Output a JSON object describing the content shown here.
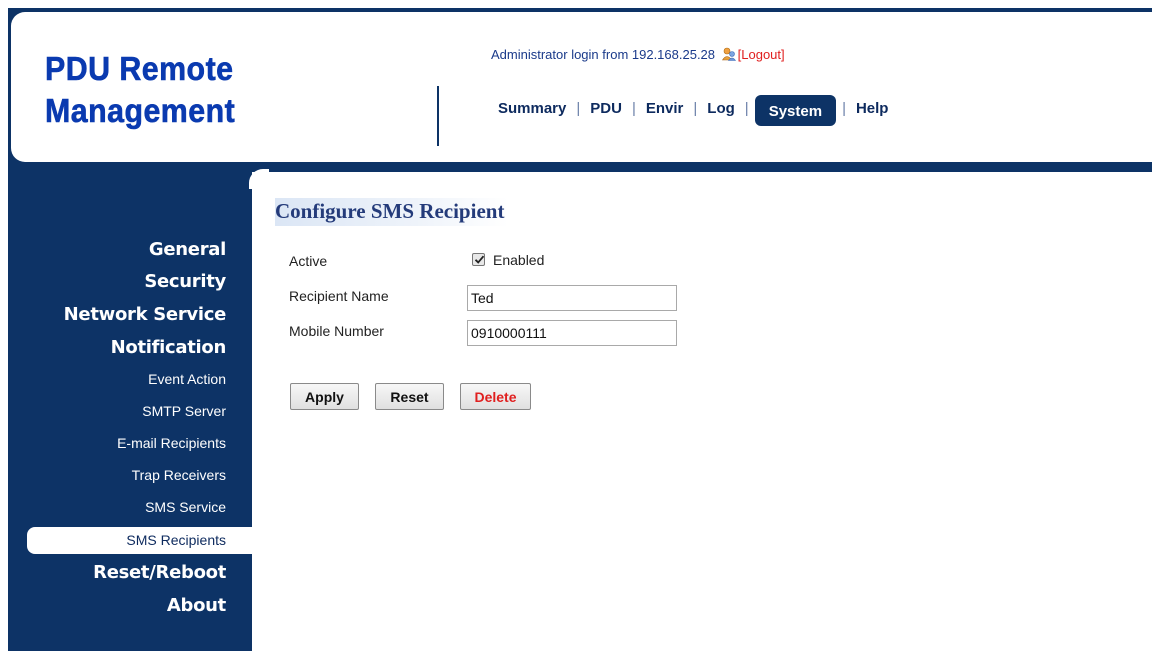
{
  "header": {
    "logo_line1": "PDU Remote",
    "logo_line2": "Management",
    "login_text": "Administrator login from 192.168.25.28",
    "logout_label": "[Logout]",
    "user_icon": "user-icon"
  },
  "topnav": {
    "items": [
      "Summary",
      "PDU",
      "Envir",
      "Log",
      "System",
      "Help"
    ],
    "active": "System",
    "separator": "|"
  },
  "sidebar": {
    "items": [
      {
        "label": "General",
        "level": "main"
      },
      {
        "label": "Security",
        "level": "main"
      },
      {
        "label": "Network Service",
        "level": "main"
      },
      {
        "label": "Notification",
        "level": "main"
      },
      {
        "label": "Event Action",
        "level": "sub"
      },
      {
        "label": "SMTP Server",
        "level": "sub"
      },
      {
        "label": "E-mail Recipients",
        "level": "sub"
      },
      {
        "label": "Trap Receivers",
        "level": "sub"
      },
      {
        "label": "SMS Service",
        "level": "sub"
      },
      {
        "label": "SMS Recipients",
        "level": "sub",
        "active": true
      },
      {
        "label": "Reset/Reboot",
        "level": "main"
      },
      {
        "label": "About",
        "level": "main"
      }
    ]
  },
  "main": {
    "title": "Configure SMS Recipient",
    "form": {
      "active_label": "Active",
      "active_checked": true,
      "active_option": "Enabled",
      "name_label": "Recipient Name",
      "name_value": "Ted",
      "mobile_label": "Mobile Number",
      "mobile_value": "0910000111"
    },
    "buttons": {
      "apply": "Apply",
      "reset": "Reset",
      "delete": "Delete"
    }
  },
  "colors": {
    "navy": "#0d3366",
    "logo_blue": "#0a3ab0",
    "delete_red": "#e02020",
    "logout_red": "#e02020"
  }
}
